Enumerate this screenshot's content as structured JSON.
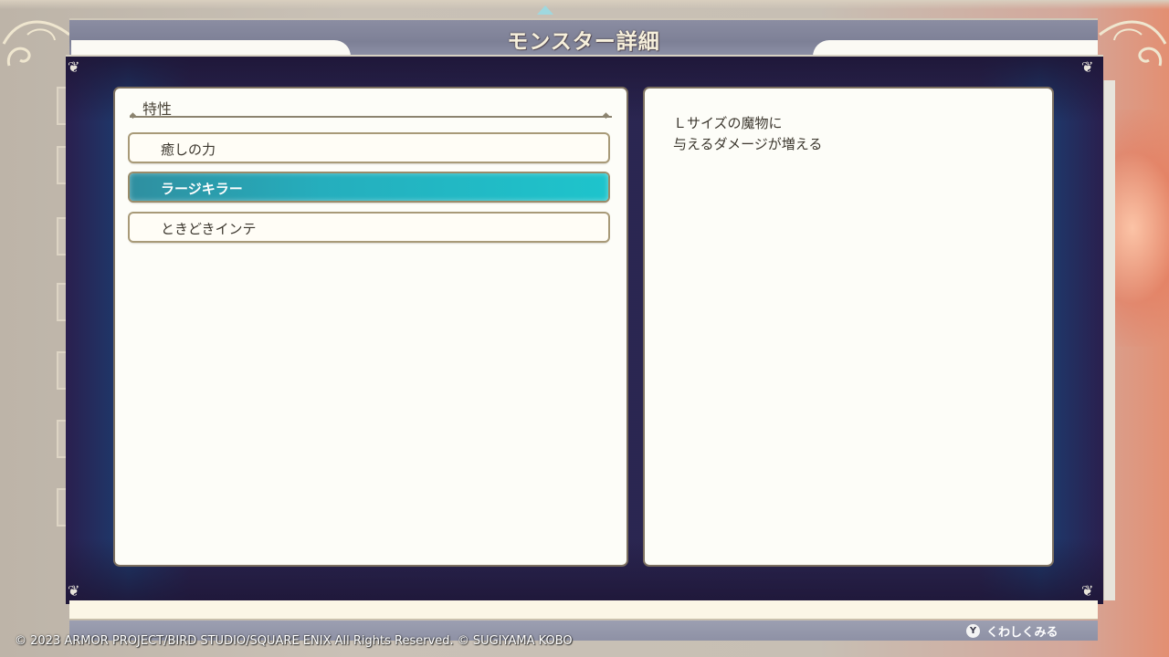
{
  "title": "モンスター詳細",
  "traits": {
    "header": "特性",
    "items": [
      {
        "label": "癒しの力",
        "selected": false
      },
      {
        "label": "ラージキラー",
        "selected": true
      },
      {
        "label": "ときどきインテ",
        "selected": false
      }
    ]
  },
  "description": {
    "line1": "Ｌサイズの魔物に",
    "line2": "与えるダメージが増える"
  },
  "footer": {
    "button_glyph": "Y",
    "hint_label": "くわしくみる",
    "copyright": "© 2023 ARMOR PROJECT/BIRD STUDIO/SQUARE ENIX All Rights Reserved. © SUGIYAMA KOBO"
  },
  "colors": {
    "frame_dark": "#2a2550",
    "frame_blue": "#1c3d70",
    "selected_accent": "#1ec4cc",
    "panel_bg": "#fdfdf8",
    "title_bar": "#7d8096"
  }
}
